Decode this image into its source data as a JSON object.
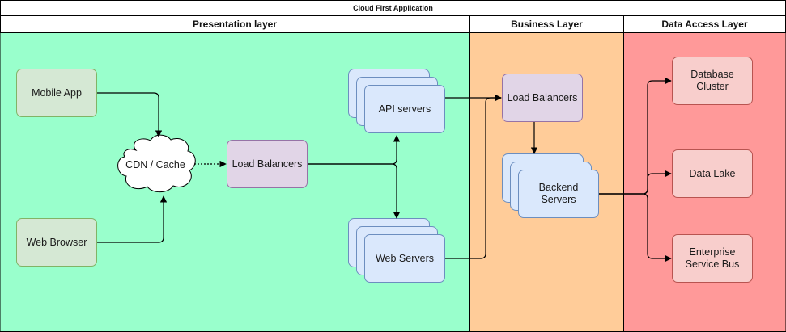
{
  "title": "Cloud First Application",
  "lanes": {
    "presentation": "Presentation layer",
    "business": "Business Layer",
    "data_access": "Data Access Layer"
  },
  "colors": {
    "presentation_bg": "#99ffcc",
    "business_bg": "#ffcc99",
    "data_access_bg": "#ff9999"
  },
  "nodes": {
    "mobile_app": "Mobile App",
    "web_browser": "Web Browser",
    "cdn_cache": "CDN / Cache",
    "load_balancers_front": "Load Balancers",
    "api_servers": "API servers",
    "web_servers": "Web Servers",
    "load_balancers_business": "Load Balancers",
    "backend_servers": "Backend Servers",
    "database_cluster": "Database Cluster",
    "data_lake": "Data Lake",
    "enterprise_service_bus": "Enterprise Service Bus"
  }
}
